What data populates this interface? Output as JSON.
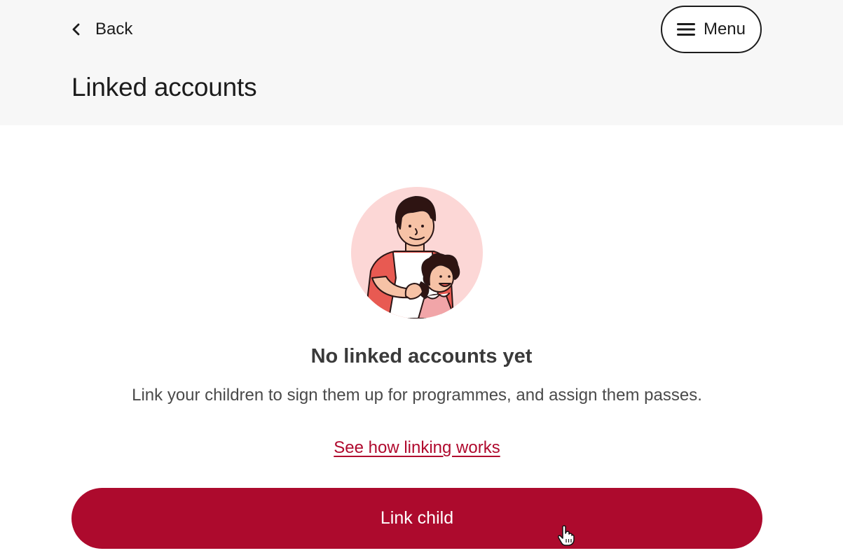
{
  "header": {
    "back_label": "Back",
    "menu_label": "Menu",
    "title": "Linked accounts"
  },
  "empty_state": {
    "title": "No linked accounts yet",
    "description": "Link your children to sign them up for programmes, and assign them passes.",
    "help_link": "See how linking works",
    "illustration": "parent-and-child-illustration"
  },
  "actions": {
    "primary_label": "Link child"
  },
  "icons": {
    "back": "chevron-left-icon",
    "menu": "hamburger-icon",
    "cursor": "hand-pointer-cursor"
  },
  "colors": {
    "brand": "#ad0a2d",
    "link": "#b00a2e",
    "header_bg": "#f7f7f7",
    "illustration_bg": "#fcd7d6"
  }
}
